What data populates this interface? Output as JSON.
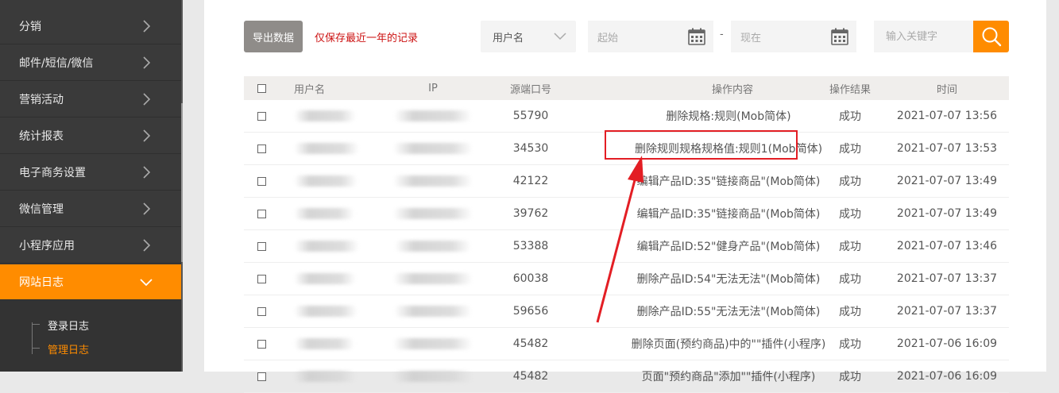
{
  "sidebar": {
    "items": [
      {
        "label": "分销"
      },
      {
        "label": "邮件/短信/微信"
      },
      {
        "label": "营销活动"
      },
      {
        "label": "统计报表"
      },
      {
        "label": "电子商务设置"
      },
      {
        "label": "微信管理"
      },
      {
        "label": "小程序应用"
      },
      {
        "label": "网站日志"
      }
    ],
    "subitems": [
      {
        "label": "登录日志"
      },
      {
        "label": "管理日志"
      }
    ]
  },
  "toolbar": {
    "export_label": "导出数据",
    "notice": "仅保存最近一年的记录",
    "filter_field": "用户名",
    "date_start_placeholder": "起始",
    "date_separator": "-",
    "date_end_placeholder": "现在",
    "search_placeholder": "输入关键字"
  },
  "table": {
    "headers": {
      "user": "用户名",
      "ip": "IP",
      "port": "源端口号",
      "op": "操作内容",
      "result": "操作结果",
      "time": "时间"
    },
    "rows": [
      {
        "port": "55790",
        "op": "删除规格:规则(Mob简体)",
        "result": "成功",
        "time": "2021-07-07 13:56"
      },
      {
        "port": "34530",
        "op": "删除规则规格规格值:规则1(Mob简体)",
        "result": "成功",
        "time": "2021-07-07 13:53"
      },
      {
        "port": "42122",
        "op": "编辑产品ID:35\"链接商品\"(Mob简体)",
        "result": "成功",
        "time": "2021-07-07 13:49"
      },
      {
        "port": "39762",
        "op": "编辑产品ID:35\"链接商品\"(Mob简体)",
        "result": "成功",
        "time": "2021-07-07 13:49"
      },
      {
        "port": "53388",
        "op": "编辑产品ID:52\"健身产品\"(Mob简体)",
        "result": "成功",
        "time": "2021-07-07 13:46"
      },
      {
        "port": "60038",
        "op": "删除产品ID:54\"无法无法\"(Mob简体)",
        "result": "成功",
        "time": "2021-07-07 13:37"
      },
      {
        "port": "59656",
        "op": "删除产品ID:55\"无法无法\"(Mob简体)",
        "result": "成功",
        "time": "2021-07-07 13:37"
      },
      {
        "port": "45482",
        "op": "删除页面(预约商品)中的\"\"插件(小程序)",
        "result": "成功",
        "time": "2021-07-06 16:09"
      },
      {
        "port": "45482",
        "op": "页面\"预约商品\"添加\"\"插件(小程序)",
        "result": "成功",
        "time": "2021-07-06 16:09"
      }
    ]
  },
  "colors": {
    "accent": "#ff8c00",
    "sidebar_bg": "#3a3a3a",
    "annotation": "#e31e24"
  }
}
